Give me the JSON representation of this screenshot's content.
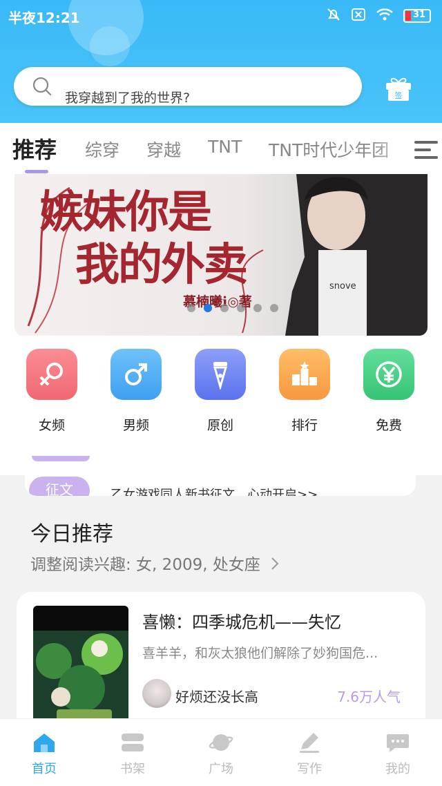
{
  "status_bar": {
    "time": "半夜12:21",
    "battery": "31"
  },
  "search": {
    "placeholder": "我穿越到了我的世界?"
  },
  "gift_label": "签",
  "tabs": [
    {
      "label": "推荐"
    },
    {
      "label": "综穿"
    },
    {
      "label": "穿越"
    },
    {
      "label": "TNT"
    },
    {
      "label": "TNT时代少年团"
    }
  ],
  "banner": {
    "title_line1": "嫉妹你是",
    "title_line2": "我的外卖",
    "author": "慕楠曦i◎著",
    "shirt_text": "snove",
    "slide_count": 6,
    "active_slide": 2
  },
  "categories": [
    {
      "label": "女频",
      "icon": "female-icon",
      "color": "#f5737f"
    },
    {
      "label": "男频",
      "icon": "male-icon",
      "color": "#52aef4"
    },
    {
      "label": "原创",
      "icon": "pen-icon",
      "color": "#6f86f2"
    },
    {
      "label": "排行",
      "icon": "ranking-icon",
      "color": "#fba54f"
    },
    {
      "label": "免费",
      "icon": "yen-icon",
      "color": "#3fcf82"
    }
  ],
  "notice": {
    "badge": "征文",
    "text": "乙女游戏同人新书征文，心动开启>>"
  },
  "section": {
    "title": "今日推荐",
    "subtitle": "调整阅读兴趣: 女, 2009, 处女座"
  },
  "book": {
    "title": "喜懒：四季城危机——失忆",
    "desc": "喜羊羊，和灰太狼他们解除了妙狗国危...",
    "author": "好烦还没长高",
    "popularity": "7.6万人气"
  },
  "bottom_nav": [
    {
      "label": "首页",
      "icon": "home-icon",
      "active": true
    },
    {
      "label": "书架",
      "icon": "bookshelf-icon",
      "active": false
    },
    {
      "label": "广场",
      "icon": "planet-icon",
      "active": false
    },
    {
      "label": "写作",
      "icon": "write-icon",
      "active": false
    },
    {
      "label": "我的",
      "icon": "chat-icon",
      "active": false
    }
  ]
}
